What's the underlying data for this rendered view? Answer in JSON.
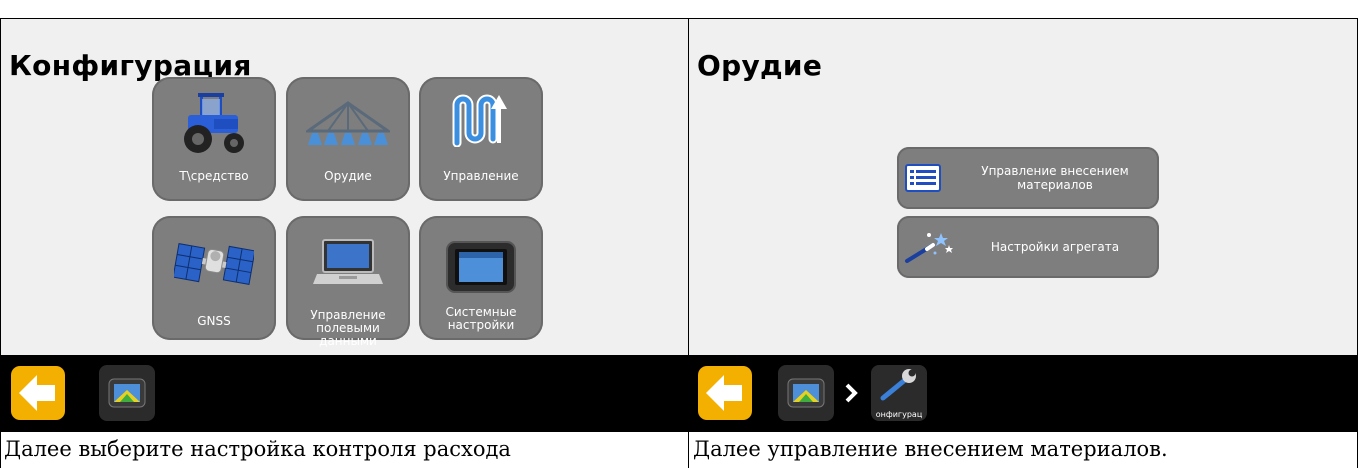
{
  "left": {
    "title": "Конфигурация",
    "tiles": [
      {
        "label": "Т\\средство",
        "icon": "tractor-icon"
      },
      {
        "label": "Орудие",
        "icon": "sprayer-boom-icon"
      },
      {
        "label": "Управление",
        "icon": "steering-path-icon"
      },
      {
        "label": "GNSS",
        "icon": "satellite-icon"
      },
      {
        "label": "Управление полевыми данными",
        "icon": "laptop-icon"
      },
      {
        "label": "Системные настройки",
        "icon": "display-icon"
      }
    ],
    "caption": "Далее выберите настройка контроля расхода"
  },
  "right": {
    "title": "Орудие",
    "buttons": [
      {
        "label": "Управление внесением материалов",
        "icon": "list-icon"
      },
      {
        "label": "Настройки агрегата",
        "icon": "magic-wand-icon"
      }
    ],
    "breadcrumb_label": "онфигурац",
    "caption": "Далее управление внесением материалов."
  },
  "colors": {
    "screen_bg": "#f0f0f0",
    "tile": "#7e7e7e",
    "back_button": "#f3b000",
    "taskbar": "#000000"
  }
}
